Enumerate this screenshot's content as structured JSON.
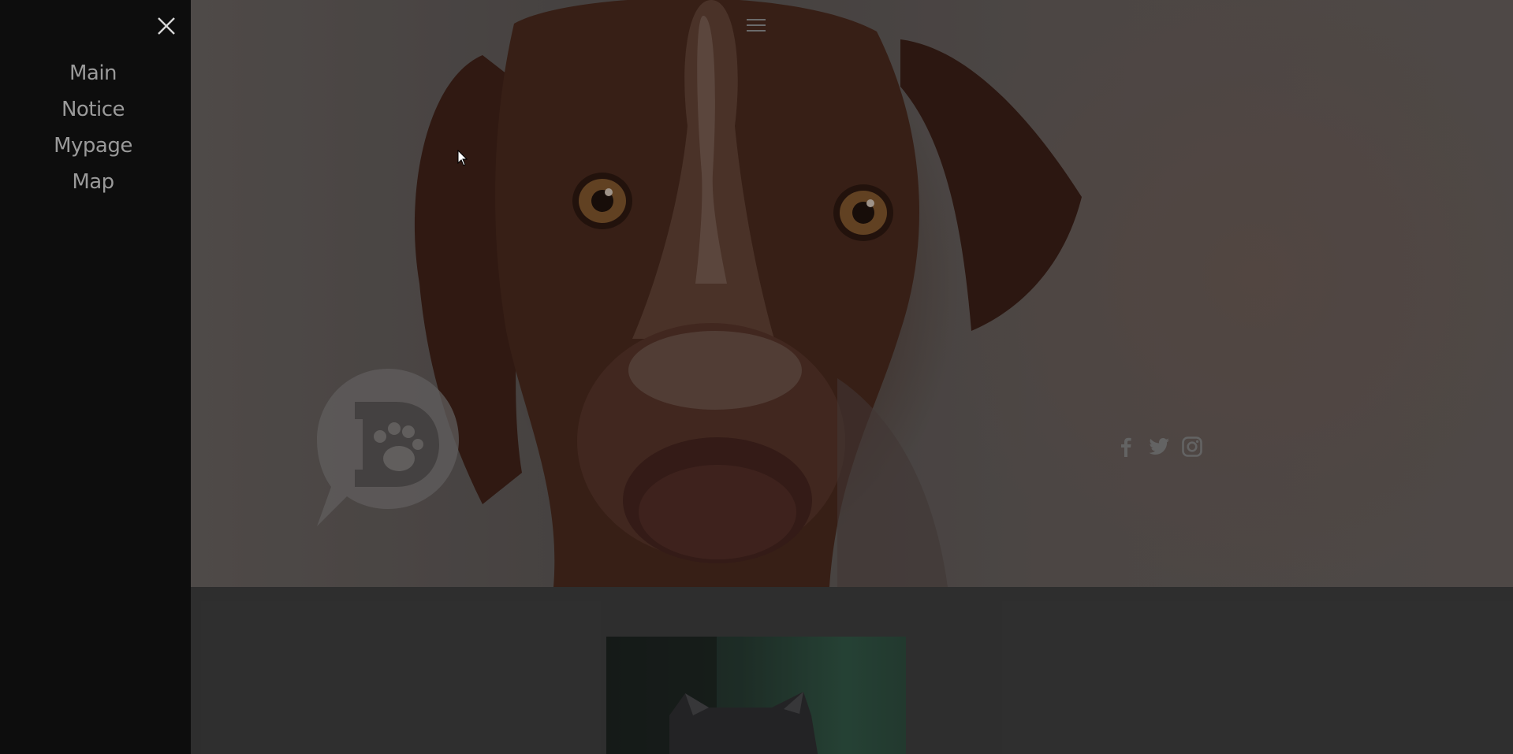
{
  "side_menu": {
    "items": [
      {
        "label": "Main"
      },
      {
        "label": "Notice"
      },
      {
        "label": "Mypage"
      },
      {
        "label": "Map"
      }
    ],
    "close_icon": "close-icon"
  },
  "header": {
    "menu_icon": "hamburger-menu-icon"
  },
  "hero": {
    "image": "dog-photo",
    "logo_icon": "paw-speech-bubble-logo-icon"
  },
  "social": {
    "icons": [
      "facebook-icon",
      "twitter-icon",
      "instagram-icon"
    ]
  },
  "colors": {
    "menu_background": "#0d0d0d",
    "menu_text": "#9a9a9a",
    "overlay": "#3a3a3a"
  }
}
